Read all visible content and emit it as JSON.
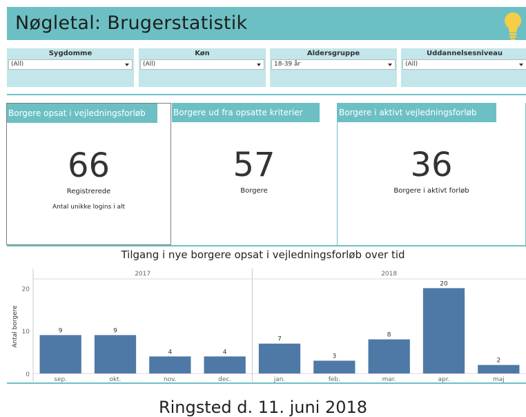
{
  "header": {
    "title": "Nøgletal: Brugerstatistik",
    "icon": "lightbulb-icon",
    "bg_color": "#6cc0c4",
    "icon_color": "#f5cd47"
  },
  "filters": [
    {
      "label": "Sygdomme",
      "value": "(All)"
    },
    {
      "label": "Køn",
      "value": "(All)"
    },
    {
      "label": "Aldersgruppe",
      "value": "18-39 år"
    },
    {
      "label": "Uddannelsesniveau",
      "value": "(All)"
    }
  ],
  "kpis": [
    {
      "title": "Borgere opsat i vejledningsforløb",
      "value": "66",
      "caption": "Registrerede",
      "note": "Antal unikke logins i alt"
    },
    {
      "title": "Borgere ud fra opsatte kriterier",
      "value": "57",
      "caption": "Borgere"
    },
    {
      "title": "Borgere i aktivt vejledningsforløb",
      "value": "36",
      "caption": "Borgere i aktivt forløb"
    }
  ],
  "chart_data": {
    "type": "bar",
    "title": "Tilgang i nye borgere opsat i vejledningsforløb over tid",
    "ylabel": "Antal borgere",
    "xlabel": "",
    "ylim": [
      0,
      22
    ],
    "yticks": [
      0,
      10,
      20
    ],
    "groups": [
      {
        "name": "2017",
        "categories": [
          "sep.",
          "okt.",
          "nov.",
          "dec."
        ],
        "values": [
          9,
          9,
          4,
          4
        ]
      },
      {
        "name": "2018",
        "categories": [
          "jan.",
          "feb.",
          "mar.",
          "apr.",
          "maj"
        ],
        "values": [
          7,
          3,
          8,
          20,
          2
        ]
      }
    ],
    "bar_color": "#4e79a7",
    "grid": false
  },
  "footer": {
    "text": "Ringsted d. 11. juni 2018"
  }
}
